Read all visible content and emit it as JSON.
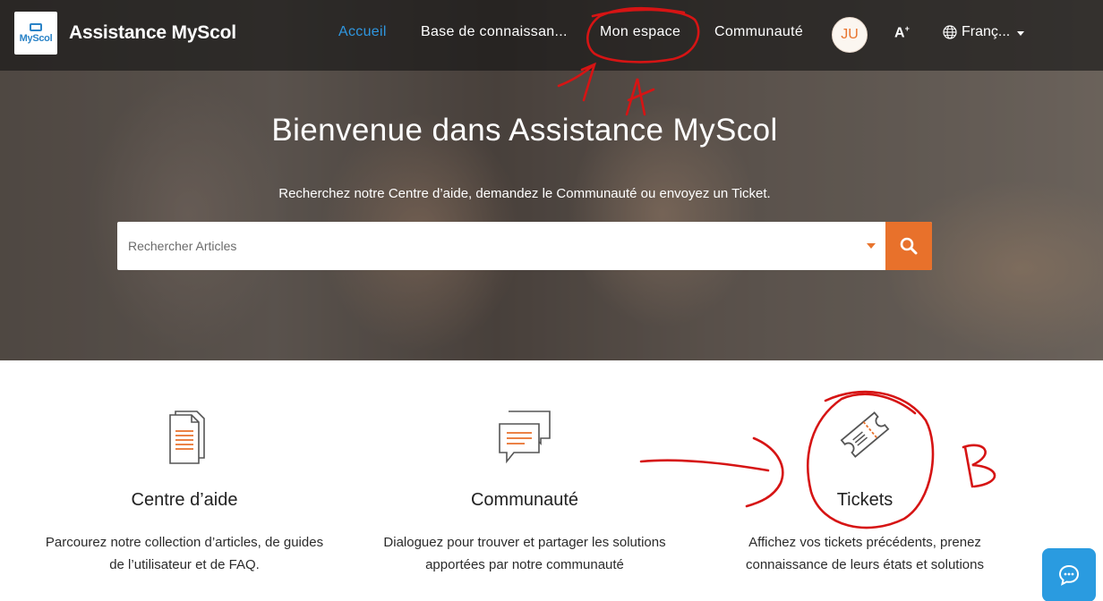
{
  "header": {
    "logo_text": "MyScol",
    "brand": "Assistance MyScol",
    "nav": [
      {
        "label": "Accueil",
        "active": true
      },
      {
        "label": "Base de connaissan..."
      },
      {
        "label": "Mon espace"
      },
      {
        "label": "Communauté"
      }
    ],
    "avatar_initials": "JU",
    "font_size_toggle": "A",
    "language": "Franç...",
    "icons": [
      "globe-icon",
      "chevron-down-icon"
    ]
  },
  "hero": {
    "title": "Bienvenue dans Assistance MyScol",
    "subtitle": "Recherchez notre Centre d’aide, demandez le Communauté ou envoyez un Ticket.",
    "search_placeholder": "Rechercher Articles"
  },
  "features": [
    {
      "title": "Centre d’aide",
      "desc_line1": "Parcourez notre collection d’articles, de guides",
      "desc_line2": "de l’utilisateur et de FAQ.",
      "icon": "document-icon"
    },
    {
      "title": "Communauté",
      "desc_line1": "Dialoguez pour trouver et partager les solutions",
      "desc_line2": "apportées par notre communauté",
      "icon": "chat-bubbles-icon"
    },
    {
      "title": "Tickets",
      "desc_line1": "Affichez vos tickets précédents, prenez",
      "desc_line2": "connaissance de leurs états et solutions",
      "icon": "ticket-icon"
    }
  ],
  "annotations": {
    "label_a": "A",
    "label_b": "B"
  },
  "colors": {
    "accent": "#e8712b",
    "link_active": "#2f96df",
    "chat": "#2a9be0"
  }
}
